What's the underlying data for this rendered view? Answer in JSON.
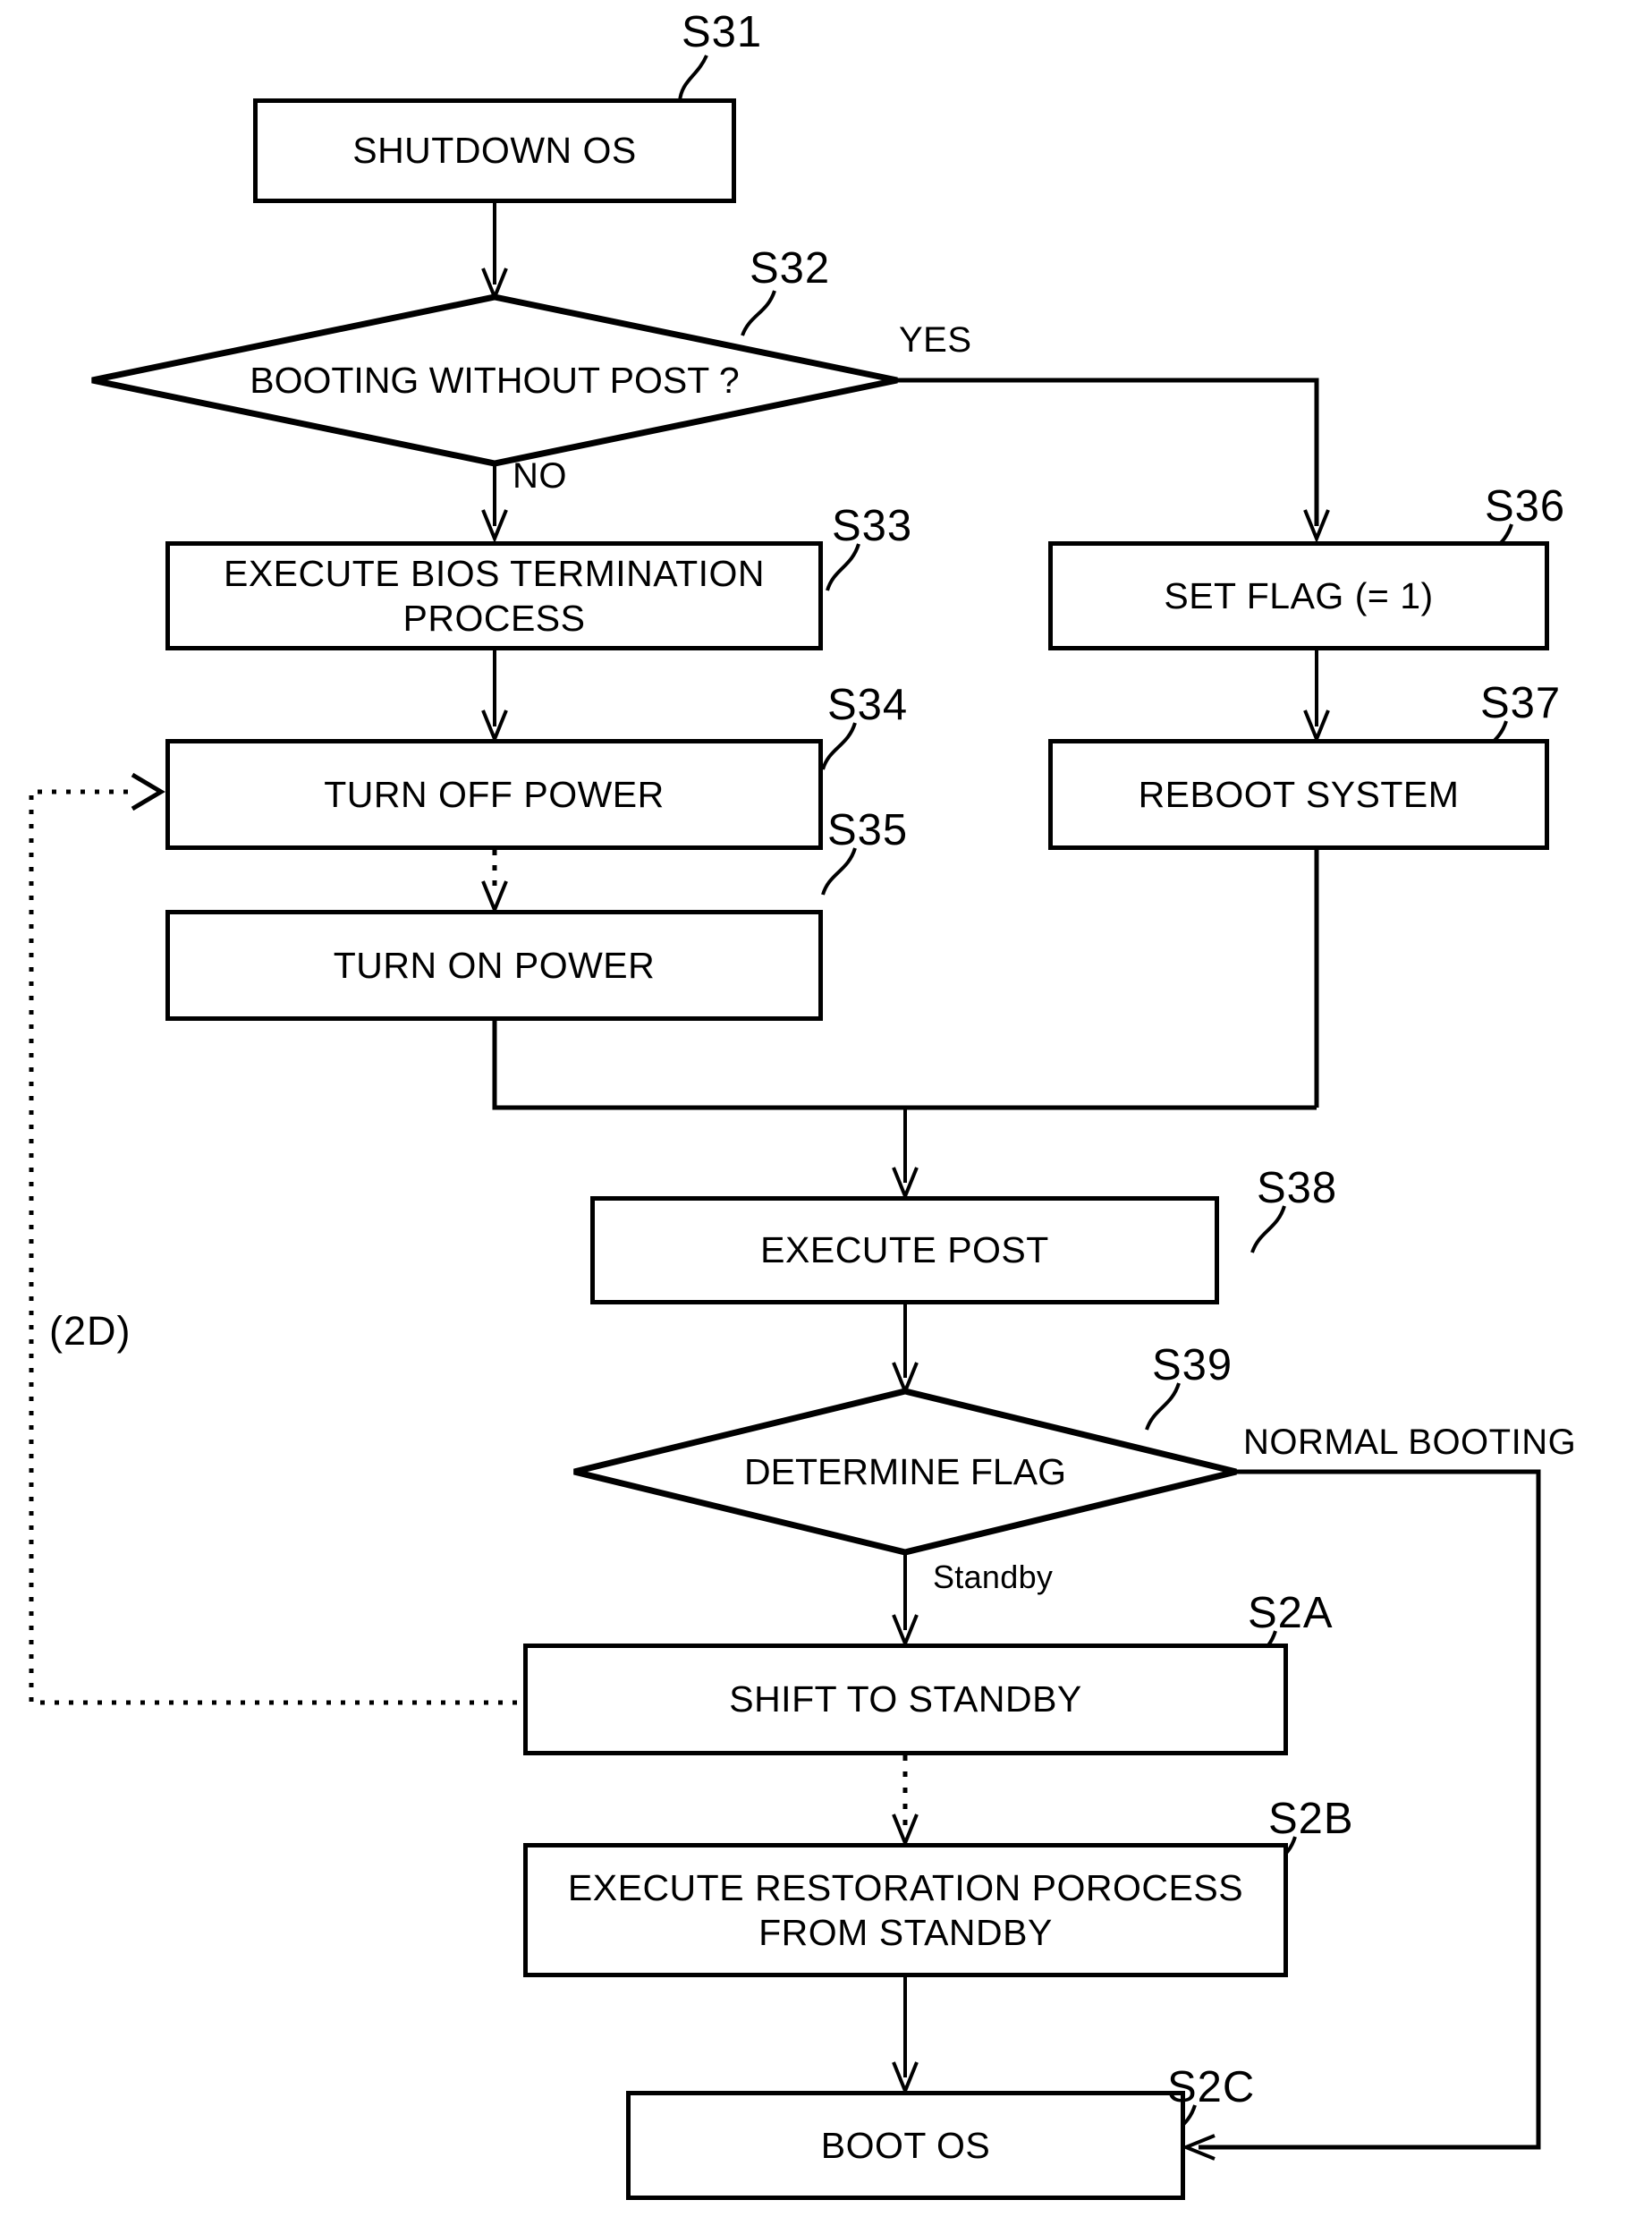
{
  "figure": {
    "type": "flowchart",
    "nodes": [
      {
        "id": "S31",
        "ref": "S31",
        "shape": "process",
        "text": "SHUTDOWN OS"
      },
      {
        "id": "S32",
        "ref": "S32",
        "shape": "decision",
        "text": "BOOTING WITHOUT POST ?"
      },
      {
        "id": "S33",
        "ref": "S33",
        "shape": "process",
        "text": "EXECUTE BIOS TERMINATION PROCESS"
      },
      {
        "id": "S34",
        "ref": "S34",
        "shape": "process",
        "text": "TURN OFF POWER"
      },
      {
        "id": "S35",
        "ref": "S35",
        "shape": "process",
        "text": "TURN ON POWER"
      },
      {
        "id": "S36",
        "ref": "S36",
        "shape": "process",
        "text": "SET FLAG (= 1)"
      },
      {
        "id": "S37",
        "ref": "S37",
        "shape": "process",
        "text": "REBOOT SYSTEM"
      },
      {
        "id": "S38",
        "ref": "S38",
        "shape": "process",
        "text": "EXECUTE  POST"
      },
      {
        "id": "S39",
        "ref": "S39",
        "shape": "decision",
        "text": "DETERMINE FLAG"
      },
      {
        "id": "S2A",
        "ref": "S2A",
        "shape": "process",
        "text": "SHIFT TO STANDBY"
      },
      {
        "id": "S2B",
        "ref": "S2B",
        "shape": "process",
        "text": "EXECUTE RESTORATION POROCESS\nFROM STANDBY"
      },
      {
        "id": "S2C",
        "ref": "S2C",
        "shape": "process",
        "text": "BOOT OS"
      }
    ],
    "edge_labels": {
      "yes": "YES",
      "no": "NO",
      "normal_booting": "NORMAL BOOTING",
      "standby": "Standby"
    },
    "annotations": {
      "feedback_tag": "(2D)"
    },
    "colors": {
      "line": "#000000",
      "background": "#ffffff",
      "text": "#000000"
    }
  }
}
